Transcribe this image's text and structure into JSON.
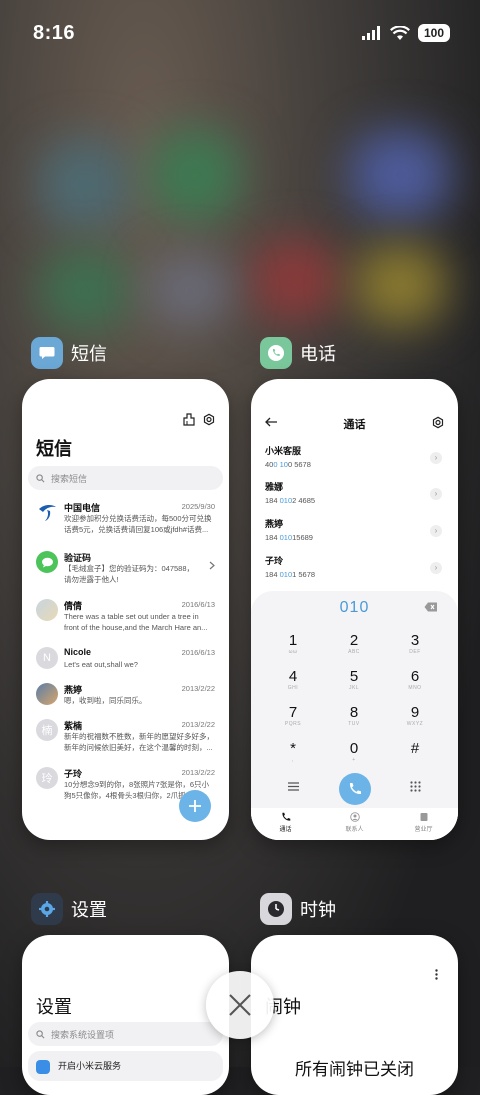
{
  "status_bar": {
    "time": "8:16",
    "battery": "100"
  },
  "apps": {
    "sms": {
      "label": "短信",
      "title": "短信",
      "search_placeholder": "搜索短信",
      "conversations": [
        {
          "name": "中国电信",
          "date": "2025/9/30",
          "message": "欢迎参加积分兑换话费活动，每500分可兑换话费5元，兑换话费请回复106或jfdh#话费..."
        },
        {
          "name": "验证码",
          "date": "",
          "message": "【毛绒盒子】您的验证码为：047588，请勿泄露于他人!"
        },
        {
          "name": "倩倩",
          "date": "2016/6/13",
          "message": "There was a table set out under a tree in front of the house,and the March Hare an..."
        },
        {
          "name": "Nicole",
          "date": "2016/6/13",
          "message": "Let's eat out,shall we?"
        },
        {
          "name": "燕婷",
          "date": "2013/2/22",
          "message": "嗯，收到啦，同乐同乐。"
        },
        {
          "name": "紫楠",
          "date": "2013/2/22",
          "message": "新年的祝福数不胜数，新年的愿望好多好多，新年的问候依旧美好，在这个温馨的时刻，..."
        },
        {
          "name": "子玲",
          "date": "2013/2/22",
          "message": "10分想念9到的你，8张照片7张是你，6只小狗5只像你，4根骨头3根归你，2爪抓..."
        }
      ],
      "avatar_letters": {
        "nicole": "N",
        "zinan": "楠",
        "ziling": "玲"
      }
    },
    "phone": {
      "label": "电话",
      "title": "通话",
      "contacts": [
        {
          "name": "小米客服",
          "pre": "40",
          "hl": "0 10",
          "post": "0 5678"
        },
        {
          "name": "雅娜",
          "pre": "184 ",
          "hl": "010",
          "post": "2 4685"
        },
        {
          "name": "燕婷",
          "pre": "184 ",
          "hl": "010",
          "post": "15689"
        },
        {
          "name": "子玲",
          "pre": "184 ",
          "hl": "010",
          "post": "1 5678"
        }
      ],
      "dialed": "010",
      "keys": [
        {
          "d": "1",
          "l": "ωω"
        },
        {
          "d": "2",
          "l": "ABC"
        },
        {
          "d": "3",
          "l": "DEF"
        },
        {
          "d": "4",
          "l": "GHI"
        },
        {
          "d": "5",
          "l": "JKL"
        },
        {
          "d": "6",
          "l": "MNO"
        },
        {
          "d": "7",
          "l": "PQRS"
        },
        {
          "d": "8",
          "l": "TUV"
        },
        {
          "d": "9",
          "l": "WXYZ"
        },
        {
          "d": "*",
          "l": ","
        },
        {
          "d": "0",
          "l": "+"
        },
        {
          "d": "#",
          "l": ""
        }
      ],
      "tabs": [
        "通话",
        "联系人",
        "营业厅"
      ]
    },
    "settings": {
      "label": "设置",
      "title": "设置",
      "search_placeholder": "搜索系统设置项",
      "first_item": "开启小米云服务"
    },
    "clock": {
      "label": "时钟",
      "title": "闹钟",
      "message": "所有闹钟已关闭"
    }
  },
  "colors": {
    "accent": "#6cb4e8",
    "highlight": "#4a9ad8"
  }
}
